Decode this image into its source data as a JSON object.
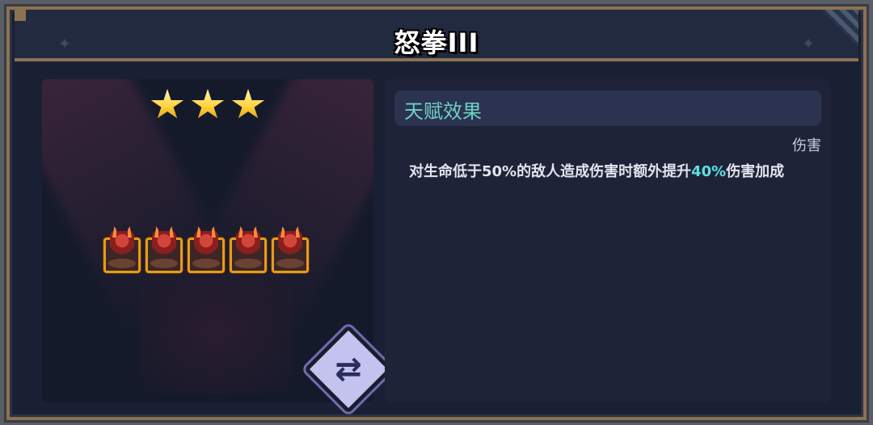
{
  "title": "怒拳III",
  "stars": {
    "count": 3
  },
  "units": {
    "count": 5
  },
  "talent": {
    "section_title": "天赋效果",
    "tag": "伤害",
    "desc_before": "对生命低于50%的敌人造成伤害时额外提升",
    "desc_highlight": "40%",
    "desc_after": "伤害加成"
  },
  "colors": {
    "highlight": "#5fe0e0",
    "section_title": "#6fd0c4",
    "star": "#ffd23c",
    "unit_border": "#e79a1d"
  },
  "icons": {
    "swap": "swap-arrows-icon",
    "star": "star-icon",
    "unit": "demon-unit-icon"
  }
}
